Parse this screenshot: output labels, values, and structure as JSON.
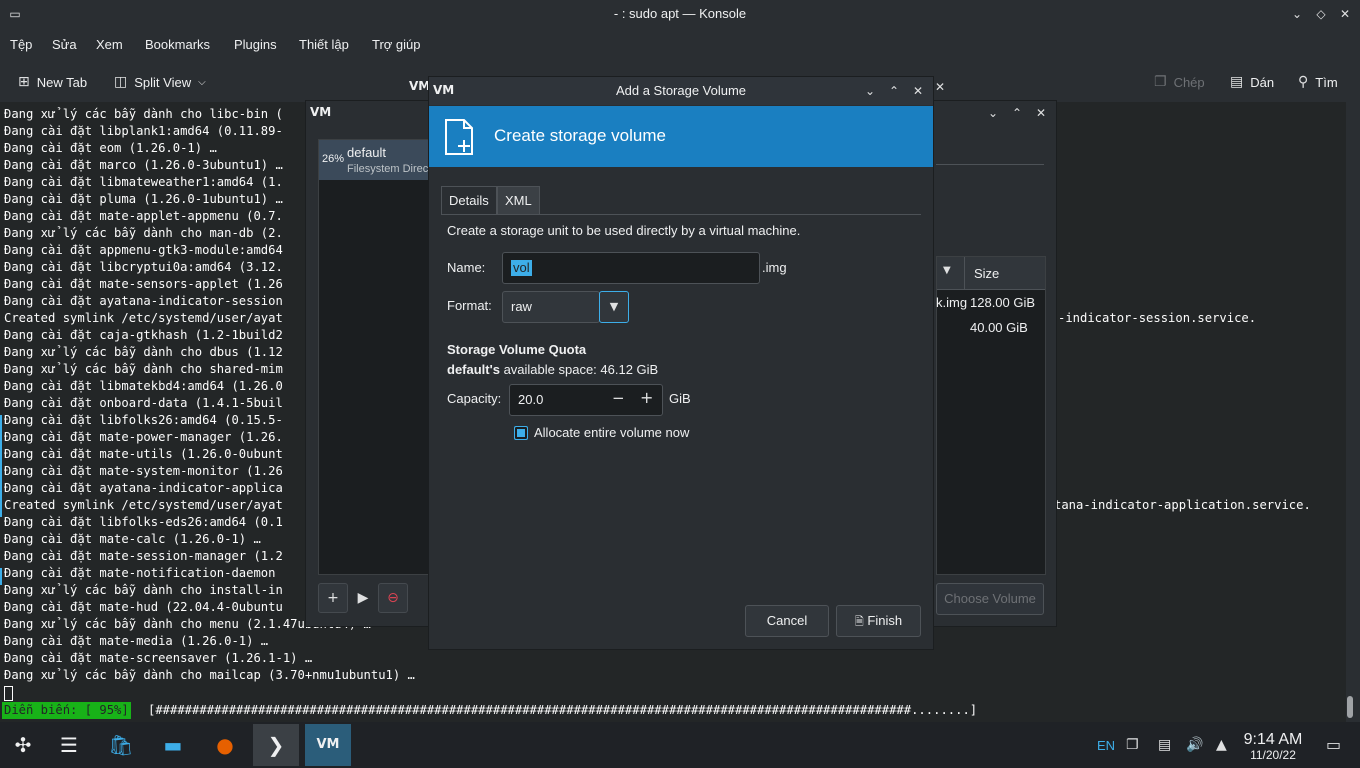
{
  "konsole": {
    "title": "- : sudo apt — Konsole",
    "menu": [
      "Tệp",
      "Sửa",
      "Xem",
      "Bookmarks",
      "Plugins",
      "Thiết lập",
      "Trợ giúp"
    ],
    "toolbar": {
      "new_tab": "New Tab",
      "split_view": "Split View",
      "copy": "Chép",
      "paste": "Dán",
      "find": "Tìm"
    },
    "terminal_lines": [
      "Đang xử lý các bẫy dành cho libc-bin (",
      "Đang cài đặt libplank1:amd64 (0.11.89-",
      "Đang cài đặt eom (1.26.0-1) …",
      "Đang cài đặt marco (1.26.0-3ubuntu1) …",
      "Đang cài đặt libmateweather1:amd64 (1.",
      "Đang cài đặt pluma (1.26.0-1ubuntu1) …",
      "Đang cài đặt mate-applet-appmenu (0.7.",
      "Đang xử lý các bẫy dành cho man-db (2.",
      "Đang cài đặt appmenu-gtk3-module:amd64",
      "Đang cài đặt libcryptui0a:amd64 (3.12.",
      "Đang cài đặt mate-sensors-applet (1.26",
      "Đang cài đặt ayatana-indicator-session",
      "Created symlink /etc/systemd/user/ayat",
      "Đang cài đặt caja-gtkhash (1.2-1build2",
      "Đang xử lý các bẫy dành cho dbus (1.12",
      "Đang xử lý các bẫy dành cho shared-mim",
      "Đang cài đặt libmatekbd4:amd64 (1.26.0",
      "Đang cài đặt onboard-data (1.4.1-5buil",
      "Đang cài đặt libfolks26:amd64 (0.15.5-",
      "Đang cài đặt mate-power-manager (1.26.",
      "Đang cài đặt mate-utils (1.26.0-0ubunt",
      "Đang cài đặt mate-system-monitor (1.26",
      "Đang cài đặt ayatana-indicator-applica",
      "Created symlink /etc/systemd/user/ayat",
      "Đang cài đặt libfolks-eds26:amd64 (0.1",
      "Đang cài đặt mate-calc (1.26.0-1) …",
      "Đang cài đặt mate-session-manager (1.2",
      "Đang cài đặt mate-notification-daemon",
      "Đang xử lý các bẫy dành cho install-in",
      "Đang cài đặt mate-hud (22.04.4-0ubuntu",
      "Đang xử lý các bẫy dành cho menu (2.1.47ubuntu4) …",
      "Đang cài đặt mate-media (1.26.0-1) …",
      "Đang cài đặt mate-screensaver (1.26.1-1) …",
      "Đang xử lý các bẫy dành cho mailcap (3.70+nmu1ubuntu1) …"
    ],
    "right_fragments": [
      "-indicator-session.service.",
      "tana-indicator-application.service."
    ],
    "progress_label": "Diễn biến: [ 95%]",
    "progress_bar": "[#######################################################################################################........]"
  },
  "vm_main": {
    "pool_percent": "26%",
    "pool_name": "default",
    "pool_type": "Filesystem Direc",
    "size_header": "Size",
    "rows": [
      {
        "name_fragment": "k.img",
        "size": "128.00 GiB"
      },
      {
        "name_fragment": "",
        "size": "40.00 GiB"
      }
    ],
    "choose_volume": "Choose Volume"
  },
  "dialog": {
    "title": "Add a Storage Volume",
    "header": "Create storage volume",
    "tabs": [
      "Details",
      "XML"
    ],
    "description": "Create a storage unit to be used directly by a virtual machine.",
    "name_label": "Name:",
    "name_value": "vol",
    "name_suffix": ".img",
    "format_label": "Format:",
    "format_value": "raw",
    "quota_title": "Storage Volume Quota",
    "pool_bold": "default's",
    "available_text": "available space: 46.12 GiB",
    "capacity_label": "Capacity:",
    "capacity_value": "20.0",
    "capacity_unit": "GiB",
    "allocate_label": "Allocate entire volume now",
    "allocate_checked": true,
    "cancel": "Cancel",
    "finish": "Finish"
  },
  "taskbar": {
    "language": "EN",
    "time": "9:14 AM",
    "date": "11/20/22"
  },
  "colors": {
    "accent": "#3daee9",
    "dialog_header": "#1a7fc1",
    "progress_green": "#18b218"
  }
}
